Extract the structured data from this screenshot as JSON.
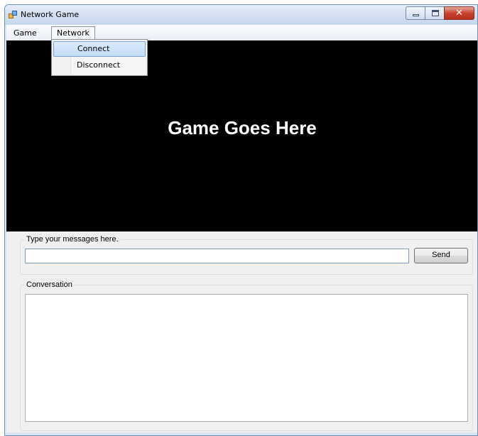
{
  "window": {
    "title": "Network Game"
  },
  "icons": {
    "app": "network-game-app-icon",
    "minimize": "minimize-icon",
    "maximize": "maximize-icon",
    "close": "close-icon"
  },
  "caption": {
    "close_glyph": "✕"
  },
  "menu": {
    "items": [
      {
        "label": "Game"
      },
      {
        "label": "Network"
      }
    ],
    "network_dropdown": [
      {
        "label": "Connect",
        "highlighted": true
      },
      {
        "label": "Disconnect",
        "highlighted": false
      }
    ]
  },
  "game_area": {
    "placeholder_text": "Game Goes Here"
  },
  "message_group": {
    "legend": "Type your messages here.",
    "input_value": "",
    "send_label": "Send"
  },
  "conversation_group": {
    "legend": "Conversation",
    "content": ""
  },
  "colors": {
    "game_background": "#000000",
    "game_text": "#ffffff",
    "menu_highlight": "#c3dcf6",
    "close_button": "#c7422f"
  }
}
